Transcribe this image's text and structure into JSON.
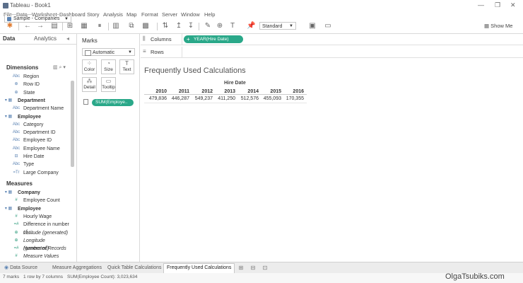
{
  "window": {
    "title": "Tableau - Book1"
  },
  "menu": [
    "File",
    "Data",
    "Worksheet",
    "Dashboard",
    "Story",
    "Analysis",
    "Map",
    "Format",
    "Server",
    "Window",
    "Help"
  ],
  "toolbar": {
    "fit_value": "Standard",
    "show_me_label": "Show Me"
  },
  "data_pane": {
    "tab_data": "Data",
    "tab_analytics": "Analytics",
    "source": "Sample - Companies",
    "dimensions_label": "Dimensions",
    "dimensions": [
      {
        "icon": "Abc",
        "label": "Region",
        "type": "field"
      },
      {
        "icon": "⊕",
        "label": "Row ID",
        "type": "field"
      },
      {
        "icon": "⊕",
        "label": "State",
        "type": "field"
      },
      {
        "icon": "▾",
        "label": "Department",
        "type": "group"
      },
      {
        "icon": "Abc",
        "label": "Department Name",
        "type": "field"
      },
      {
        "icon": "▾",
        "label": "Employee",
        "type": "group"
      },
      {
        "icon": "Abc",
        "label": "Category",
        "type": "field"
      },
      {
        "icon": "Abc",
        "label": "Department ID",
        "type": "field"
      },
      {
        "icon": "Abc",
        "label": "Employee ID",
        "type": "field"
      },
      {
        "icon": "Abc",
        "label": "Employee Name",
        "type": "field"
      },
      {
        "icon": "⊟",
        "label": "Hire Date",
        "type": "field"
      },
      {
        "icon": "Abc",
        "label": "Type",
        "type": "field"
      },
      {
        "icon": "=Tr",
        "label": "Large Company",
        "type": "field"
      }
    ],
    "measures_label": "Measures",
    "measures": [
      {
        "icon": "▾",
        "label": "Company",
        "type": "group"
      },
      {
        "icon": "#",
        "label": "Employee Count",
        "type": "field"
      },
      {
        "icon": "▾",
        "label": "Employee",
        "type": "group"
      },
      {
        "icon": "#",
        "label": "Hourly Wage",
        "type": "field"
      },
      {
        "icon": "=#",
        "label": "Difference in number of ...",
        "type": "field"
      },
      {
        "icon": "⊕",
        "label": "Latitude (generated)",
        "type": "italic"
      },
      {
        "icon": "⊕",
        "label": "Longitude (generated)",
        "type": "italic"
      },
      {
        "icon": "=#",
        "label": "Number of Records",
        "type": "italic"
      },
      {
        "icon": "#",
        "label": "Measure Values",
        "type": "italic"
      }
    ]
  },
  "marks": {
    "title": "Marks",
    "type": "Automatic",
    "buttons": [
      "Color",
      "Size",
      "Text",
      "Detail",
      "Tooltip"
    ],
    "pill": "SUM(Employe.."
  },
  "shelves": {
    "columns_label": "Columns",
    "rows_label": "Rows",
    "column_pill": "YEAR(Hire Date)"
  },
  "viz": {
    "title": "Frequently Used Calculations",
    "header": "Hire Date",
    "years": [
      "2010",
      "2011",
      "2012",
      "2013",
      "2014",
      "2015",
      "2016"
    ],
    "values": [
      "479,836",
      "446,287",
      "549,237",
      "411,250",
      "512,576",
      "455,093",
      "170,355"
    ]
  },
  "tabs": {
    "data_source": "Data Source",
    "sheets": [
      "Measure Aggregations",
      "Quick Table Calculations",
      "Frequently Used Calculations"
    ]
  },
  "status": {
    "marks": "7 marks",
    "rows_cols": "1 row by 7 columns",
    "sum": "SUM(Employee Count): 3,023,634"
  },
  "watermark": "OlgaTsubiks.com"
}
